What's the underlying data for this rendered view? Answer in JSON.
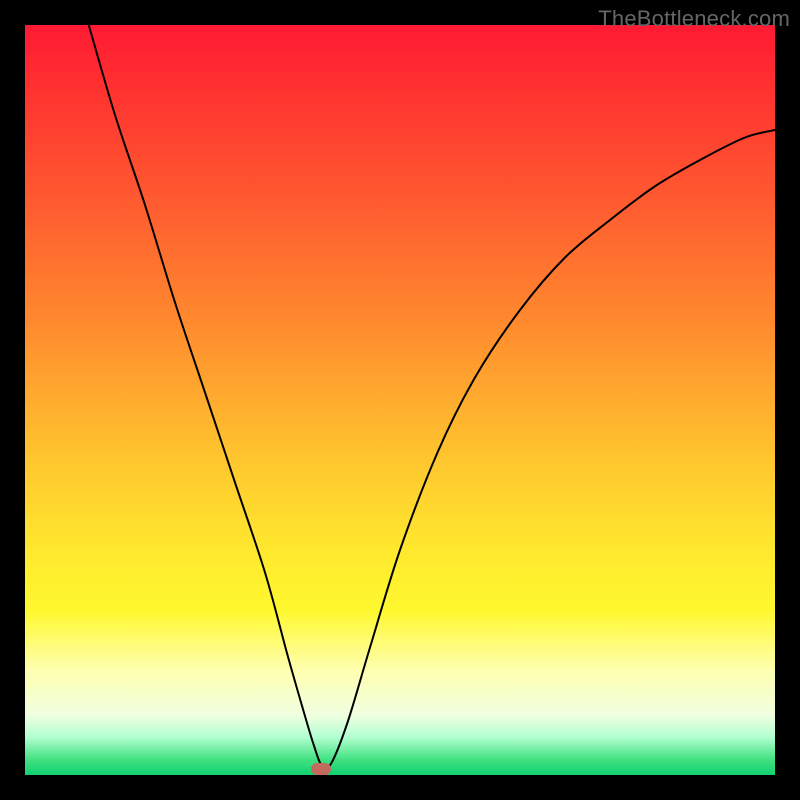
{
  "attribution": "TheBottleneck.com",
  "chart_data": {
    "type": "line",
    "title": "",
    "xlabel": "",
    "ylabel": "",
    "xlim": [
      0,
      100
    ],
    "ylim": [
      0,
      100
    ],
    "grid": false,
    "legend": false,
    "series": [
      {
        "name": "curve",
        "x": [
          8.5,
          12,
          16,
          20,
          24,
          28,
          32,
          35,
          37,
          38.5,
          39.6,
          40.8,
          43,
          46,
          50,
          55,
          60,
          66,
          72,
          78,
          84,
          90,
          96,
          100
        ],
        "y": [
          100,
          88,
          76,
          63,
          51,
          39,
          27,
          16,
          9,
          4,
          1.2,
          1.5,
          7,
          17,
          30,
          43,
          53,
          62,
          69,
          74,
          78.5,
          82,
          85,
          86
        ]
      }
    ],
    "marker": {
      "x": 39.4,
      "y": 0.8,
      "color": "#c36a5e"
    },
    "background_gradient": [
      "#ff1a33",
      "#ff8b2e",
      "#ffe82e",
      "#10d070"
    ],
    "curve_color": "#000000"
  },
  "colors": {
    "frame_border": "#000000",
    "watermark": "#666666",
    "marker": "#c36a5e"
  }
}
